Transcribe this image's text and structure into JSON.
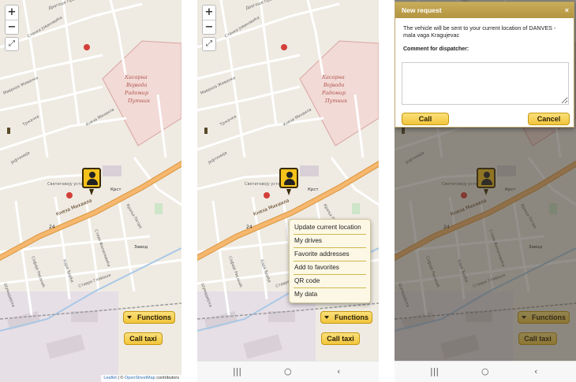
{
  "map": {
    "zoom_in": "+",
    "zoom_out": "−",
    "fullscreen_icon": "fullscreen-icon",
    "area_label_lines": [
      "Kасарна",
      "Војвода",
      "Радомир",
      "Путник"
    ],
    "street_labels": [
      "Кнеза Михаила",
      "Кнеза Михаила",
      "24",
      "Крст",
      "Завод",
      "Cvetka Jovanovica"
    ],
    "attribution_leaflet": "Leaflet",
    "attribution_sep": " | © ",
    "attribution_osm": "OpenStreetMap",
    "attribution_contrib": " contributors"
  },
  "controls": {
    "functions_label": "Functions",
    "call_taxi_label": "Call taxi"
  },
  "menu": {
    "items": [
      "Update current location",
      "My drives",
      "Favorite addresses",
      "Add to favorites",
      "QR code",
      "My data"
    ]
  },
  "dialog": {
    "title": "New request",
    "close": "×",
    "message": "The vehicle will be sent to your current location of DANVES - mala vaga Kragujevac",
    "comment_label": "Comment for dispatcher:",
    "call_label": "Call",
    "cancel_label": "Cancel"
  },
  "navbar": {
    "recent": "|||",
    "home": "○",
    "back": "‹"
  },
  "colors": {
    "accent": "#f4c21a",
    "main_road": "#f6b76e",
    "restricted_area": "#f0d6d3",
    "map_bg": "#efebe3"
  }
}
